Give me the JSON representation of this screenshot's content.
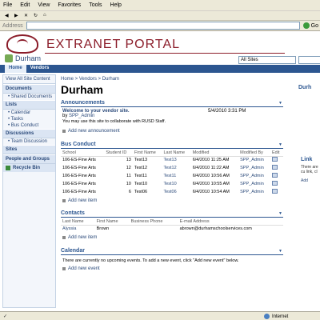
{
  "menu": [
    "File",
    "Edit",
    "View",
    "Favorites",
    "Tools",
    "Help"
  ],
  "address": {
    "label": "Address",
    "go": "Go"
  },
  "portal": {
    "title": "EXTRANET PORTAL",
    "site": "Durham",
    "search_scope": "All Sites"
  },
  "tabs": [
    "Home",
    "Vendors"
  ],
  "nav": {
    "all_content": "View All Site Content",
    "sections": [
      {
        "head": "Documents",
        "items": [
          "Shared Documents"
        ]
      },
      {
        "head": "Lists",
        "items": [
          "Calendar",
          "Tasks",
          "Bus Conduct"
        ]
      },
      {
        "head": "Discussions",
        "items": [
          "Team Discussion"
        ]
      },
      {
        "head": "Sites",
        "items": []
      },
      {
        "head": "People and Groups",
        "items": []
      }
    ],
    "recycle": "Recycle Bin"
  },
  "breadcrumb": "Home > Vendors > Durham",
  "page_title": "Durham",
  "announcements": {
    "title": "Announcements",
    "item_title": "Welcome to your vendor site.",
    "by_label": "by",
    "by_user": "SPP_Admin",
    "date": "5/4/2010 3:31 PM",
    "body": "You may use this site to collaborate with RUSD Staff.",
    "add": "Add new announcement"
  },
  "bus_conduct": {
    "title": "Bus Conduct",
    "headers": [
      "School",
      "Student ID",
      "First Name",
      "Last Name",
      "Modified",
      "Modified By",
      "Edit"
    ],
    "rows": [
      [
        "106-ES-Fine Arts",
        "13",
        "Test13",
        "Test13",
        "6/4/2010 11:25 AM",
        "SPP_Admin"
      ],
      [
        "106-ES-Fine Arts",
        "12",
        "Test12",
        "Test12",
        "6/4/2010 11:22 AM",
        "SPP_Admin"
      ],
      [
        "106-ES-Fine Arts",
        "11",
        "Test11",
        "Test11",
        "6/4/2010 10:56 AM",
        "SPP_Admin"
      ],
      [
        "106-ES-Fine Arts",
        "10",
        "Test10",
        "Test10",
        "6/4/2010 10:55 AM",
        "SPP_Admin"
      ],
      [
        "106-ES-Fine Arts",
        "6",
        "Test06",
        "Test06",
        "6/4/2010 10:54 AM",
        "SPP_Admin"
      ]
    ],
    "add": "Add new item"
  },
  "contacts": {
    "title": "Contacts",
    "headers": [
      "Last Name",
      "First Name",
      "Business Phone",
      "E-mail Address"
    ],
    "rows": [
      [
        "Alyssia",
        "Brown",
        "",
        "abrown@durhamschoolservices.com"
      ]
    ],
    "add": "Add new item"
  },
  "calendar": {
    "title": "Calendar",
    "message": "There are currently no upcoming events. To add a new event, click \"Add new event\" below.",
    "add": "Add new event"
  },
  "right": {
    "title": "Durh",
    "links_title": "Link",
    "links_text": "There are cu link, cl",
    "add": "Add"
  },
  "status": {
    "zone": "Internet"
  }
}
